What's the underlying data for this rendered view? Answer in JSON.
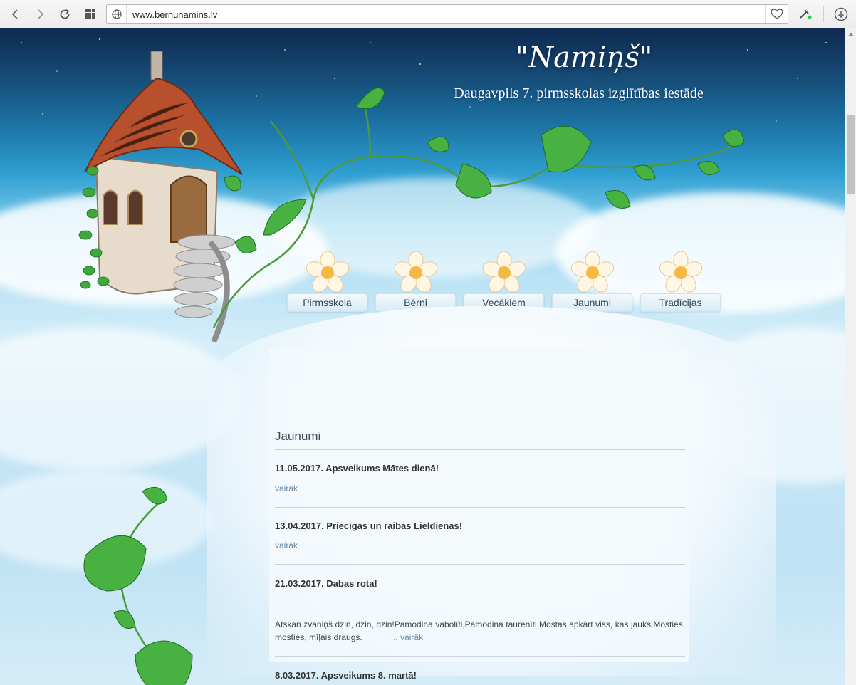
{
  "browser": {
    "url": "www.bernunamins.lv"
  },
  "header": {
    "title": "\"Namiņš\"",
    "subtitle": "Daugavpils 7. pirmsskolas izglītības iestāde"
  },
  "menu": {
    "items": [
      {
        "label": "Pirmsskola"
      },
      {
        "label": "Bērni"
      },
      {
        "label": "Vecākiem"
      },
      {
        "label": "Jaunumi"
      },
      {
        "label": "Tradīcijas"
      }
    ]
  },
  "news": {
    "section_title": "Jaunumi",
    "items": [
      {
        "title": "11.05.2017. Apsveikums Mātes dienā!",
        "more": "vairāk"
      },
      {
        "title": "13.04.2017. Priecīgas un raibas Lieldienas!",
        "more": "vairāk"
      },
      {
        "title": "21.03.2017. Dabas rota!",
        "text": "Atskan zvaniņš dzin, dzin, dzin!Pamodina vabolīti,Pamodina taurenīti,Mostas apkārt viss, kas jauks,Mosties, mosties, mīļais draugs.",
        "more": "... vairāk"
      },
      {
        "title": "8.03.2017. Apsveikums 8. martā!"
      }
    ]
  },
  "colors": {
    "sky_top": "#0e2a4f",
    "sky_mid": "#2e9ed0",
    "leaf": "#3fa83a",
    "link": "#6b8aa4"
  }
}
